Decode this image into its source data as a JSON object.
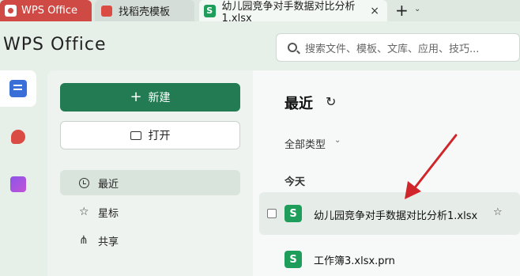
{
  "tabs": [
    {
      "label": "WPS Office"
    },
    {
      "label": "找稻壳模板"
    },
    {
      "label": "幼儿园竞争对手数据对比分析1.xlsx",
      "close": "×",
      "icon": "S"
    }
  ],
  "tab_actions": {
    "add": "+",
    "dropdown": "⌄"
  },
  "header": {
    "brand": "WPS Office"
  },
  "search": {
    "placeholder": "搜索文件、模板、文库、应用、技巧..."
  },
  "rail": [
    {
      "icon": "documents-icon"
    },
    {
      "icon": "docer-icon"
    },
    {
      "icon": "apps-icon"
    }
  ],
  "sidebar": {
    "new_label": "新建",
    "open_label": "打开",
    "items": [
      {
        "label": "最近",
        "icon": "clock-icon"
      },
      {
        "label": "星标",
        "icon": "star-icon"
      },
      {
        "label": "共享",
        "icon": "share-icon"
      }
    ]
  },
  "main": {
    "title": "最近",
    "filter": "全部类型",
    "group": "今天",
    "files": [
      {
        "icon": "S",
        "name": "幼儿园竞争对手数据对比分析1.xlsx"
      },
      {
        "icon": "S",
        "name": "工作簿3.xlsx.prn"
      }
    ]
  },
  "colors": {
    "accent": "#227b52",
    "wps_red": "#cf4a44",
    "sheet_green": "#1f9e5b",
    "arrow": "#d0262b"
  }
}
